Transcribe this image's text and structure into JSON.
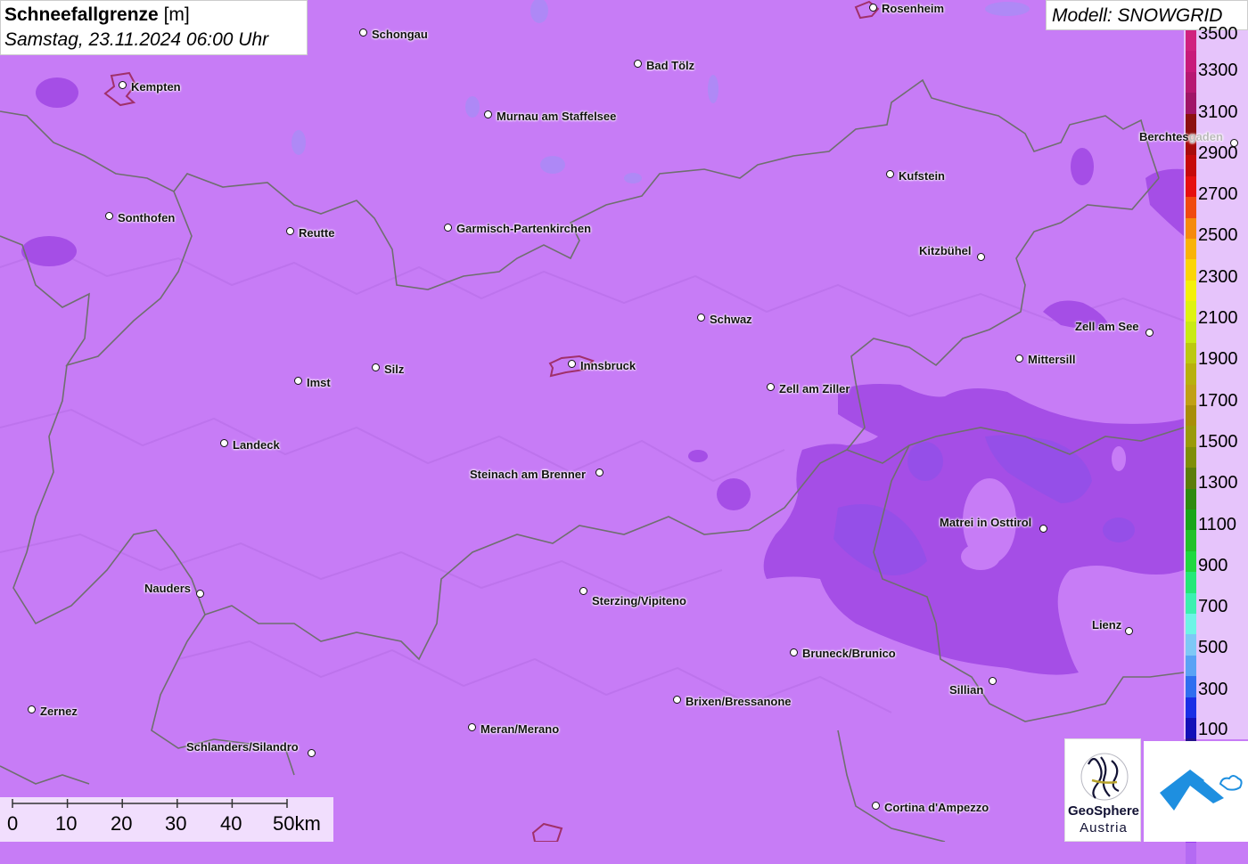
{
  "title": {
    "parameter": "Schneefallgrenze",
    "unit": "[m]",
    "datetime": "Samstag, 23.11.2024 06:00 Uhr"
  },
  "model": "Modell: SNOWGRID",
  "colors": {
    "background_field": "#c77cf6",
    "low_field": "#a54ee6",
    "lowest_field": "#8e3ad8",
    "border_line": "#6f6f6f",
    "city_outline": "#a0306a"
  },
  "legend": {
    "labels": [
      "3500",
      "3300",
      "3100",
      "2900",
      "2700",
      "2500",
      "2300",
      "2100",
      "1900",
      "1700",
      "1500",
      "1300",
      "1100",
      "900",
      "700",
      "500",
      "300",
      "100"
    ],
    "colors": [
      "#d0217f",
      "#c81a7a",
      "#b71872",
      "#a01568",
      "#8c1010",
      "#a80c0c",
      "#c60a0a",
      "#e60f0f",
      "#f04a10",
      "#f58a0c",
      "#f9b307",
      "#fbd507",
      "#f5f00a",
      "#dff312",
      "#c9ea14",
      "#bcc811",
      "#b8b00e",
      "#c0a016",
      "#a88d0a",
      "#9a9a0a",
      "#7f8e08",
      "#5c7d0a",
      "#2f8a10",
      "#1aa51a",
      "#23c12a",
      "#20d840",
      "#24e878",
      "#3cf0b0",
      "#6ef4e6",
      "#7ec8f6",
      "#5aa2f5",
      "#2f6ef0",
      "#1a2ee6",
      "#1410b8",
      "#23128a",
      "#3c1b92",
      "#5a13d0",
      "#7a10e8",
      "#9b3af0",
      "#b46af3"
    ]
  },
  "cities": [
    {
      "name": "Rosenheim"
    },
    {
      "name": "Schongau"
    },
    {
      "name": "Kempten"
    },
    {
      "name": "Bad Tölz"
    },
    {
      "name": "Murnau am Staffelsee"
    },
    {
      "name": "Berchtesgaden"
    },
    {
      "name": "Kufstein"
    },
    {
      "name": "Sonthofen"
    },
    {
      "name": "Reutte"
    },
    {
      "name": "Garmisch-Partenkirchen"
    },
    {
      "name": "Kitzbühel"
    },
    {
      "name": "Schwaz"
    },
    {
      "name": "Zell am See"
    },
    {
      "name": "Mittersill"
    },
    {
      "name": "Innsbruck"
    },
    {
      "name": "Silz"
    },
    {
      "name": "Imst"
    },
    {
      "name": "Zell am Ziller"
    },
    {
      "name": "Landeck"
    },
    {
      "name": "Steinach am Brenner"
    },
    {
      "name": "Matrei in Osttirol"
    },
    {
      "name": "Nauders"
    },
    {
      "name": "Sterzing/Vipiteno"
    },
    {
      "name": "Lienz"
    },
    {
      "name": "Bruneck/Brunico"
    },
    {
      "name": "Sillian"
    },
    {
      "name": "Zernez"
    },
    {
      "name": "Brixen/Bressanone"
    },
    {
      "name": "Meran/Merano"
    },
    {
      "name": "Schlanders/Silandro"
    },
    {
      "name": "Cortina d'Ampezzo"
    }
  ],
  "scale": {
    "labels": [
      "0",
      "10",
      "20",
      "30",
      "40",
      "50km"
    ]
  },
  "logos": {
    "geosphere_line1": "GeoSphere",
    "geosphere_line2": "Austria"
  }
}
